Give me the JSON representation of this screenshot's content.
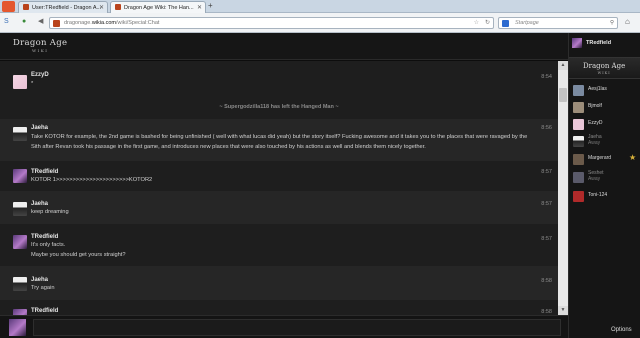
{
  "browser": {
    "tabs": [
      {
        "title": "User:TRedfield - Dragon A...",
        "favicon_color": "#b9431c",
        "active": false
      },
      {
        "title": "Dragon Age Wiki: The Han...",
        "favicon_color": "#b9431c",
        "active": true
      }
    ],
    "new_tab": "+",
    "url": {
      "prefix": "dragonage.",
      "host": "wikia.com",
      "path": "/wiki/Special:Chat"
    },
    "search_placeholder": "Startpage"
  },
  "chat": {
    "logo": {
      "main": "Dragon Age",
      "sub": "WIKI"
    },
    "messages": [
      {
        "user": "EzzyD",
        "text": "*",
        "time": "8:54",
        "avatar": "ezzy"
      },
      {
        "user": "Jaeha",
        "text": "Take KOTOR for example, the 2nd game is bashed for being unfinished ( well with what lucas did yeah) but the story itself? Fucking awesome and it takes you to the places that were ravaged by the Sith after Revan took his passage in the first game, and introduces new places that were also touched by his actions as well and blends them nicely together.",
        "time": "8:56",
        "avatar": "jaeha"
      },
      {
        "user": "TRedfield",
        "text": "KOTOR 1>>>>>>>>>>>>>>>>>>>>>>KOTOR2",
        "time": "8:57",
        "avatar": "tred"
      },
      {
        "user": "Jaeha",
        "text": "keep dreaming",
        "time": "8:57",
        "avatar": "jaeha"
      },
      {
        "user": "TRedfield",
        "text": "It's only facts.\nMaybe you should get yours straight?",
        "time": "8:57",
        "avatar": "tred"
      },
      {
        "user": "Jaeha",
        "text": "Try again",
        "time": "8:58",
        "avatar": "jaeha"
      },
      {
        "user": "TRedfield",
        "text": "",
        "time": "8:58",
        "avatar": "tred"
      }
    ],
    "inline_alert": "~ Supergodzilla118 has left the Hanged Man ~"
  },
  "sidebar": {
    "me": "TRedfield",
    "room_logo": {
      "main": "Dragon Age",
      "sub": "WIKI"
    },
    "users": [
      {
        "name": "Aesj1las",
        "status": "",
        "away": false,
        "avatar_color": "#7a8aa0"
      },
      {
        "name": "Bjmolf",
        "status": "",
        "away": false,
        "avatar_color": "#9c8d7a"
      },
      {
        "name": "EzzyD",
        "status": "",
        "away": false,
        "avatar_color": "#e9c6d8"
      },
      {
        "name": "Jaeha",
        "status": "Away",
        "away": true,
        "avatar_color": "#3a3a3a"
      },
      {
        "name": "Margerard",
        "status": "",
        "away": false,
        "avatar_color": "#6b5a4a",
        "badge": "★"
      },
      {
        "name": "Seshet",
        "status": "Away",
        "away": true,
        "avatar_color": "#5a5a6a"
      },
      {
        "name": "Toni-124",
        "status": "",
        "away": false,
        "avatar_color": "#b02a2a"
      }
    ],
    "options_label": "Options"
  }
}
